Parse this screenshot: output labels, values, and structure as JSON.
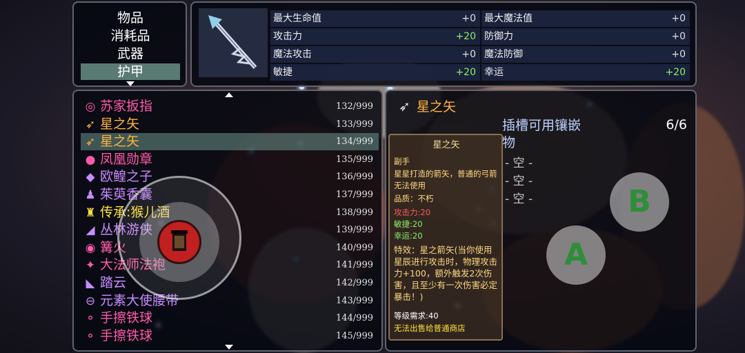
{
  "categories": {
    "items": [
      "物品",
      "消耗品",
      "武器",
      "护甲"
    ],
    "selected": 3
  },
  "weapon_stats": {
    "rows": [
      {
        "label": "最大生命值",
        "value": "+0",
        "positive": false
      },
      {
        "label": "最大魔法值",
        "value": "+0",
        "positive": false
      },
      {
        "label": "攻击力",
        "value": "+20",
        "positive": true
      },
      {
        "label": "防御力",
        "value": "+0",
        "positive": false
      },
      {
        "label": "魔法攻击",
        "value": "+0",
        "positive": false
      },
      {
        "label": "魔法防御",
        "value": "+0",
        "positive": false
      },
      {
        "label": "敏捷",
        "value": "+20",
        "positive": true
      },
      {
        "label": "幸运",
        "value": "+20",
        "positive": true
      }
    ]
  },
  "inventory": {
    "items": [
      {
        "name": "苏家扳指",
        "count": "132/999",
        "color": "#ff5aa8",
        "icon": "ring-icon",
        "glyph": "◎"
      },
      {
        "name": "星之矢",
        "count": "133/999",
        "color": "#ffb43c",
        "icon": "arrow-icon",
        "glyph": "➶"
      },
      {
        "name": "星之矢",
        "count": "134/999",
        "color": "#ffb43c",
        "icon": "arrow-icon",
        "glyph": "➶"
      },
      {
        "name": "凤凰勋章",
        "count": "135/999",
        "color": "#ff5aa8",
        "icon": "medal-icon",
        "glyph": "●"
      },
      {
        "name": "欧鳇之子",
        "count": "136/999",
        "color": "#c88cff",
        "icon": "fish-icon",
        "glyph": "◆"
      },
      {
        "name": "茱萸香囊",
        "count": "137/999",
        "color": "#c88cff",
        "icon": "pouch-icon",
        "glyph": "♟"
      },
      {
        "name": "传承:猴儿酒",
        "count": "138/999",
        "color": "#ffe23a",
        "icon": "gourd-icon",
        "glyph": "♜"
      },
      {
        "name": "丛林游侠",
        "count": "139/999",
        "color": "#c88cff",
        "icon": "boots-icon",
        "glyph": "◢"
      },
      {
        "name": "篝火",
        "count": "140/999",
        "color": "#ff5aa8",
        "icon": "fire-icon",
        "glyph": "◉"
      },
      {
        "name": "大法师法袍",
        "count": "141/999",
        "color": "#ff5aa8",
        "icon": "robe-icon",
        "glyph": "✦"
      },
      {
        "name": "踏云",
        "count": "142/999",
        "color": "#c88cff",
        "icon": "cloud-boots-icon",
        "glyph": "◣"
      },
      {
        "name": "元素大使腰带",
        "count": "143/999",
        "color": "#c88cff",
        "icon": "belt-icon",
        "glyph": "⊖"
      },
      {
        "name": "手擦铁球",
        "count": "144/999",
        "color": "#ff5aa8",
        "icon": "iron-ball-icon",
        "glyph": "⚬"
      },
      {
        "name": "手擦铁球",
        "count": "145/999",
        "color": "#ff5aa8",
        "icon": "iron-ball-icon",
        "glyph": "⚬"
      }
    ],
    "selected": 2
  },
  "detail": {
    "name": "星之矢",
    "slot_title": "插槽可用镶嵌物",
    "slot_count": "6/6",
    "slots": [
      "- 空 -",
      "- 空 -",
      "- 空 -"
    ],
    "desc": {
      "title": "星之矢",
      "type": "副手",
      "flavor": "星星打造的箭矢，普通的弓箭无法使用",
      "quality": "品质：不朽",
      "attack": "攻击力:20",
      "agility": "敏捷:20",
      "luck": "幸运:20",
      "effect": "特效：星之箭矢(当你使用星辰进行攻击时，物理攻击力+100，额外触发2次伤害，且至少有一次伤害必定暴击！)",
      "level_req": "等级需求:40",
      "shop_note": "无法出售给普通商店"
    }
  },
  "controls": {
    "button_a": "A",
    "button_b": "B"
  }
}
